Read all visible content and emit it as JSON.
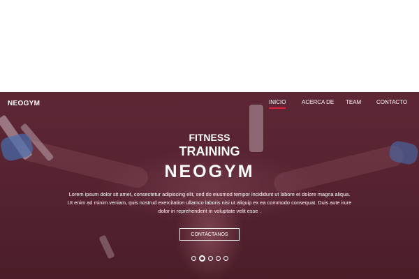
{
  "brand": {
    "logo": "NEOGYM"
  },
  "nav": {
    "items": [
      {
        "label": "INICIO",
        "active": true
      },
      {
        "label": "ACERCA DE",
        "active": false
      },
      {
        "label": "TEAM",
        "active": false
      },
      {
        "label": "CONTACTO",
        "active": false
      }
    ]
  },
  "hero": {
    "line1": "FITNESS",
    "line2": "TRAINING",
    "line3": "NEOGYM",
    "text": "Lorem ipsum dolor sit amet, consectetur adipiscing elit, sed do eiusmod tempor incididunt ut labore et dolore magna aliqua. Ut enim ad minim veniam, quis nostrud exercitation ullamco laboris nisi ut aliquip ex ea commodo consequat. Duis aute irure dolor in reprehenderit in voluptate velit esse .",
    "cta": "CONTÁCTANOS"
  },
  "slider": {
    "count": 5,
    "active_index": 1
  },
  "colors": {
    "overlay": "#5a2533",
    "nav_active_underline": "#e2213b",
    "text": "#ffffff",
    "page_background": "#ffffff"
  }
}
